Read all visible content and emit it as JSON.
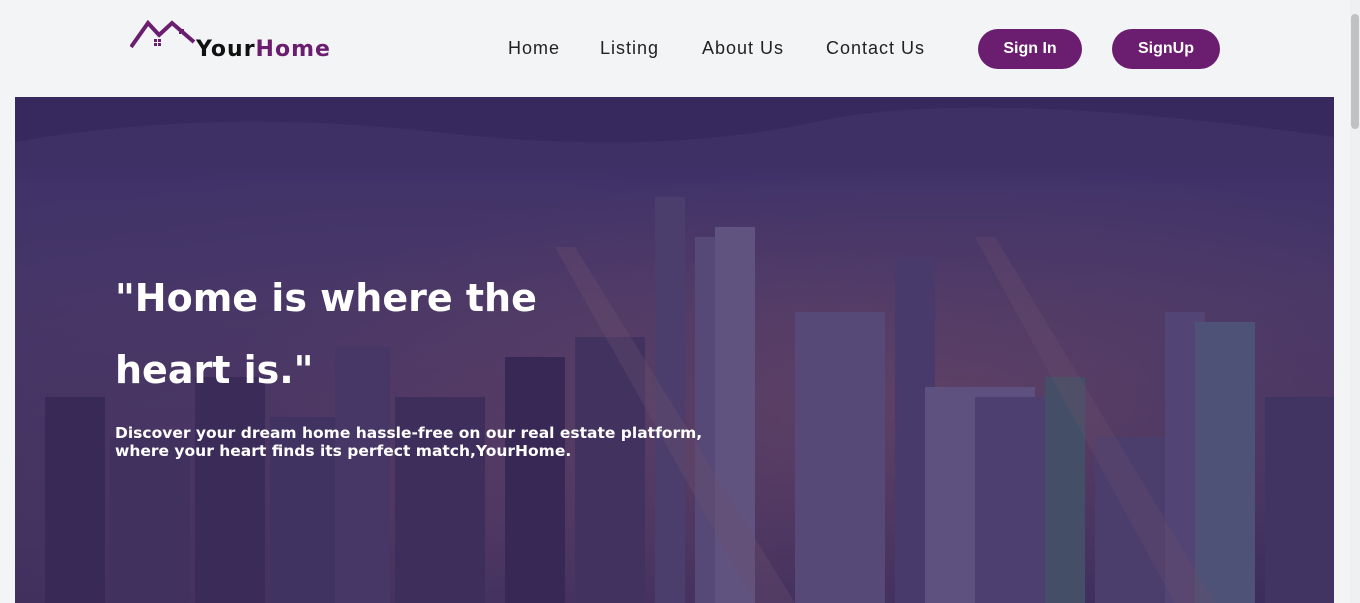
{
  "brand": {
    "name_part1": "Your",
    "name_part2": "Home",
    "logo_icon": "house-roofs-icon"
  },
  "nav": {
    "links": [
      "Home",
      "Listing",
      "About Us",
      "Contact Us"
    ]
  },
  "auth": {
    "sign_in": "Sign In",
    "sign_up": "SignUp"
  },
  "hero": {
    "headline": "\"Home is where the heart is.\"",
    "subline": "Discover your dream home hassle-free on our real estate platform, where your heart finds its perfect match,YourHome."
  },
  "colors": {
    "accent": "#6b1d6f",
    "page_bg": "#f3f4f6",
    "text": "#222222",
    "on_accent": "#ffffff"
  }
}
